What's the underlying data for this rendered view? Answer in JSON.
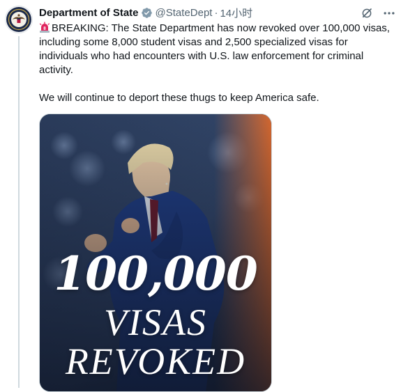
{
  "tweet": {
    "author_name": "Department of State",
    "handle": "@StateDept",
    "separator": "·",
    "time": "14小时",
    "text_p1": "BREAKING: The State Department has now revoked over 100,000 visas, including some 8,000 student visas and 2,500 specialized visas for individuals who had encounters with U.S. law enforcement for criminal activity.",
    "text_p2": "We will continue to deport these thugs to keep America safe.",
    "media": {
      "number": "100,000",
      "word1": "VISAS",
      "word2": "REVOKED"
    }
  },
  "icons": {
    "avatar": "state-department-seal",
    "verified": "verified-badge-icon",
    "grok": "grok-icon",
    "more": "more-icon",
    "siren": "siren-emoji"
  },
  "colors": {
    "verified": "#829aab",
    "text": "#0f1419",
    "secondary": "#536471",
    "siren": "#e0245e"
  }
}
